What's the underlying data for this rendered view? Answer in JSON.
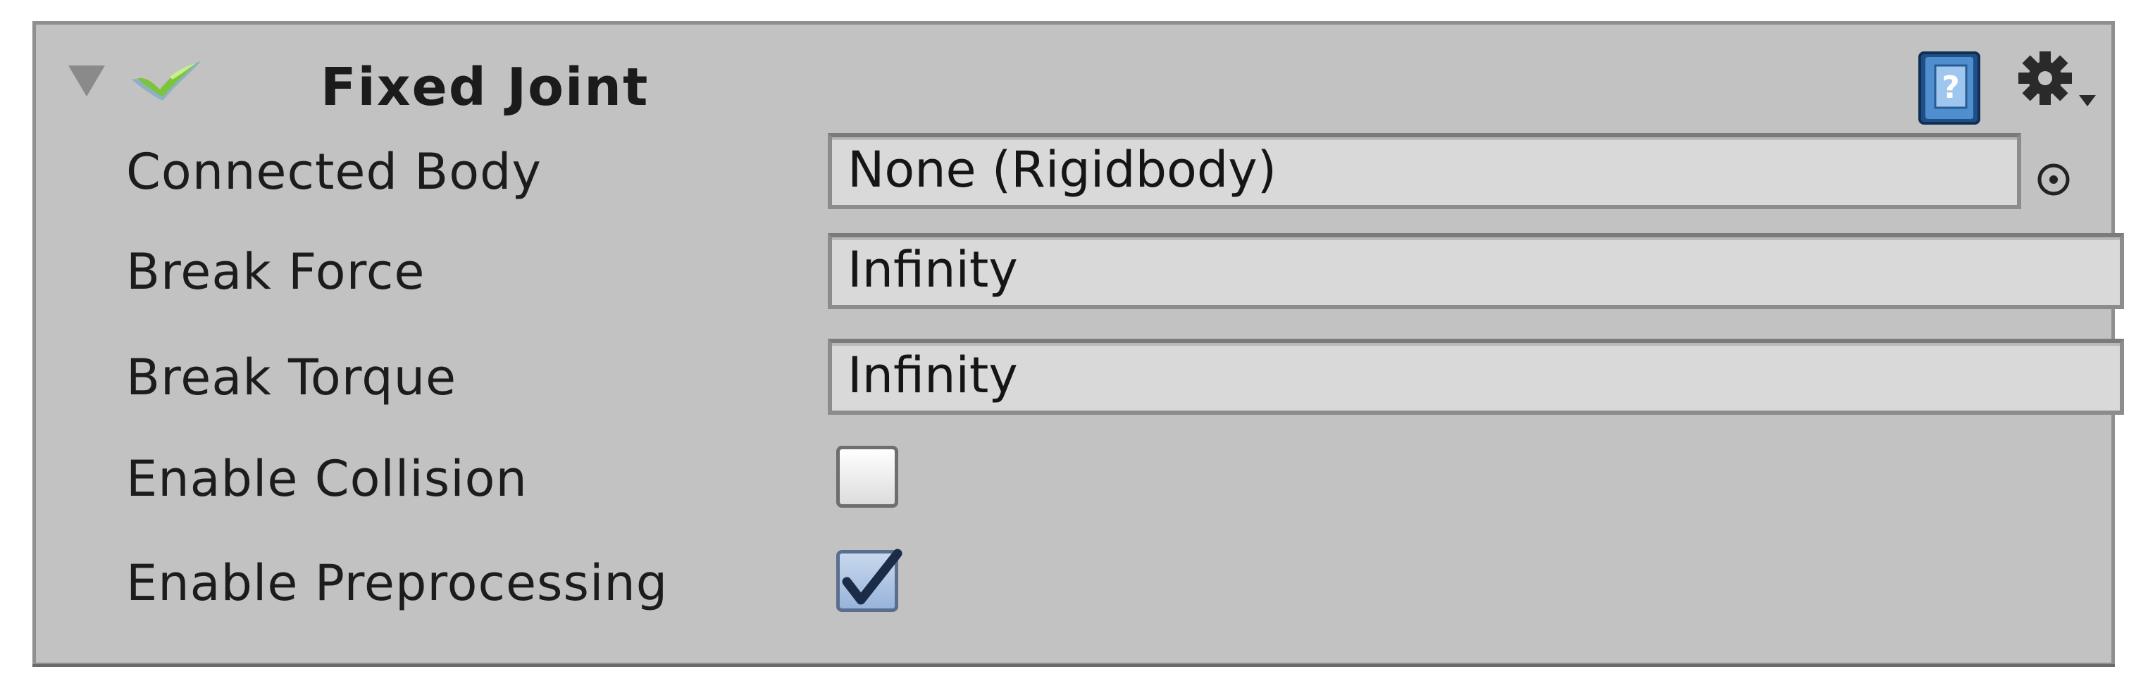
{
  "component": {
    "title": "Fixed Joint",
    "enabled": true,
    "icons": {
      "foldout": "foldout-expanded-icon",
      "enable_toggle": "joint-enabled-check-icon",
      "help": "help-book-icon",
      "settings": "gear-settings-icon",
      "object_picker": "object-picker-icon"
    }
  },
  "properties": {
    "connected_body": {
      "label": "Connected Body",
      "value": "None (Rigidbody)"
    },
    "break_force": {
      "label": "Break Force",
      "value": "Infinity"
    },
    "break_torque": {
      "label": "Break Torque",
      "value": "Infinity"
    },
    "enable_collision": {
      "label": "Enable Collision",
      "checked": false
    },
    "enable_preprocessing": {
      "label": "Enable Preprocessing",
      "checked": true
    }
  },
  "colors": {
    "panel_background": "#c2c2c2",
    "field_background": "#d9d9d9",
    "checkbox_checked": "#98b4da",
    "check_green": "#7cc43a"
  }
}
